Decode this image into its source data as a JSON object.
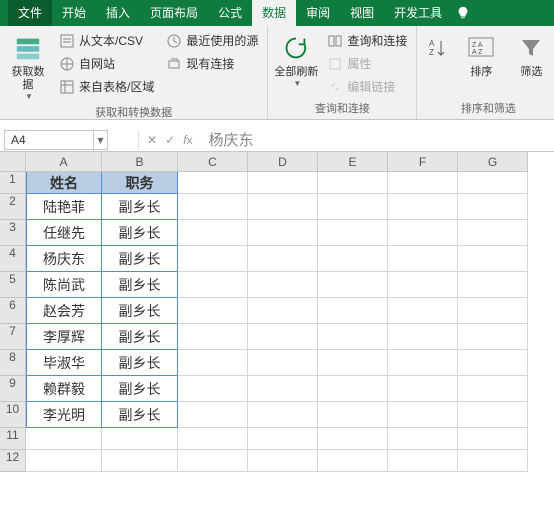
{
  "tabs": {
    "file": "文件",
    "home": "开始",
    "insert": "插入",
    "layout": "页面布局",
    "formulas": "公式",
    "data": "数据",
    "review": "审阅",
    "view": "视图",
    "dev": "开发工具"
  },
  "ribbon": {
    "get_data": "获取数\n据",
    "from_csv": "从文本/CSV",
    "from_web": "自网站",
    "from_table": "来自表格/区域",
    "recent": "最近使用的源",
    "existing": "现有连接",
    "group1": "获取和转换数据",
    "refresh": "全部刷新",
    "queries": "查询和连接",
    "props": "属性",
    "edit_links": "编辑链接",
    "group2": "查询和连接",
    "sort": "排序",
    "filter": "筛选",
    "group3": "排序和筛选"
  },
  "namebox": "A4",
  "formula": "杨庆东",
  "columns": [
    "A",
    "B",
    "C",
    "D",
    "E",
    "F",
    "G"
  ],
  "table": {
    "header": [
      "姓名",
      "职务"
    ],
    "rows": [
      [
        "陆艳菲",
        "副乡长"
      ],
      [
        "任继先",
        "副乡长"
      ],
      [
        "杨庆东",
        "副乡长"
      ],
      [
        "陈尚武",
        "副乡长"
      ],
      [
        "赵会芳",
        "副乡长"
      ],
      [
        "李厚辉",
        "副乡长"
      ],
      [
        "毕淑华",
        "副乡长"
      ],
      [
        "赖群毅",
        "副乡长"
      ],
      [
        "李光明",
        "副乡长"
      ]
    ]
  },
  "chart_data": {
    "type": "table",
    "headers": [
      "姓名",
      "职务"
    ],
    "rows": [
      [
        "陆艳菲",
        "副乡长"
      ],
      [
        "任继先",
        "副乡长"
      ],
      [
        "杨庆东",
        "副乡长"
      ],
      [
        "陈尚武",
        "副乡长"
      ],
      [
        "赵会芳",
        "副乡长"
      ],
      [
        "李厚辉",
        "副乡长"
      ],
      [
        "毕淑华",
        "副乡长"
      ],
      [
        "赖群毅",
        "副乡长"
      ],
      [
        "李光明",
        "副乡长"
      ]
    ]
  }
}
